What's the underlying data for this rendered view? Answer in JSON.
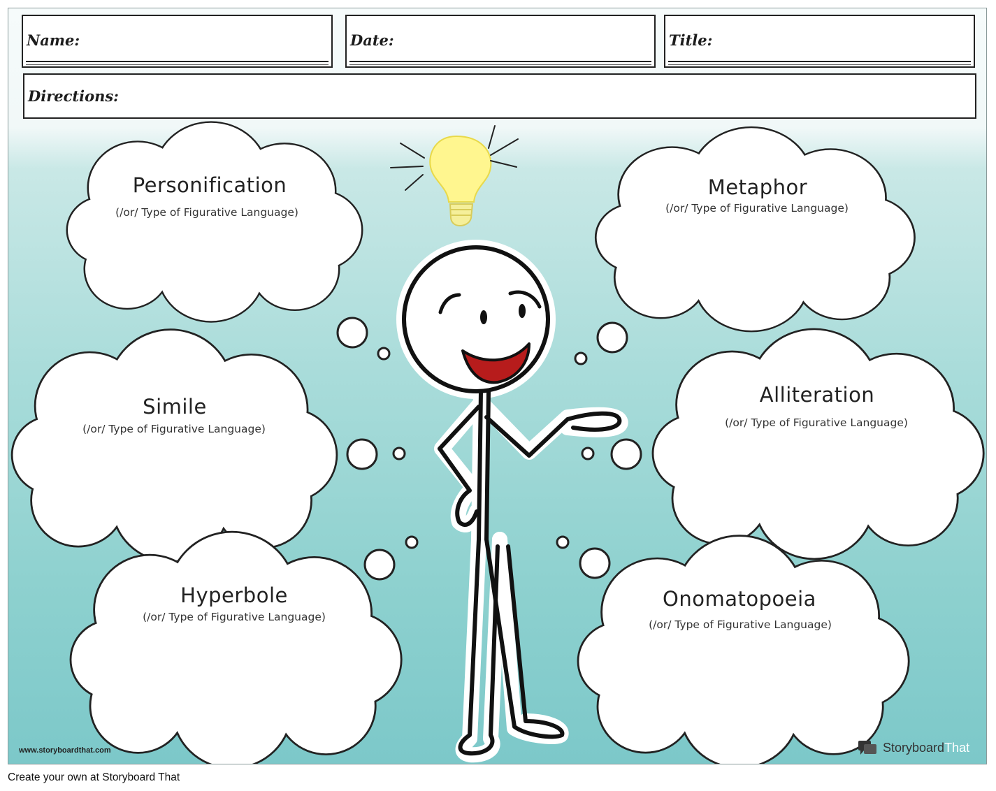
{
  "header": {
    "name_label": "Name:",
    "date_label": "Date:",
    "title_label": "Title:",
    "directions_label": "Directions:"
  },
  "clouds": [
    {
      "title": "Personification",
      "subtitle": "(/or/ Type of Figurative Language)"
    },
    {
      "title": "Metaphor",
      "subtitle": "(/or/ Type of Figurative Language)"
    },
    {
      "title": "Simile",
      "subtitle": "(/or/ Type of Figurative Language)"
    },
    {
      "title": "Alliteration",
      "subtitle": "(/or/ Type of Figurative Language)"
    },
    {
      "title": "Hyperbole",
      "subtitle": "(/or/ Type of Figurative Language)"
    },
    {
      "title": "Onomatopoeia",
      "subtitle": "(/or/ Type of Figurative Language)"
    }
  ],
  "watermark": {
    "site": "www.storyboardthat.com",
    "brand_storyboard": "Storyboard",
    "brand_that": "That"
  },
  "footer": {
    "text": "Create your own at Storyboard That"
  },
  "colors": {
    "background_top": "#f1f8f8",
    "background_bottom": "#7cc8c9",
    "bulb": "#fff68f",
    "mouth": "#b71c1c"
  },
  "icons": [
    "lightbulb-icon",
    "storyboardthat-logo-icon"
  ]
}
